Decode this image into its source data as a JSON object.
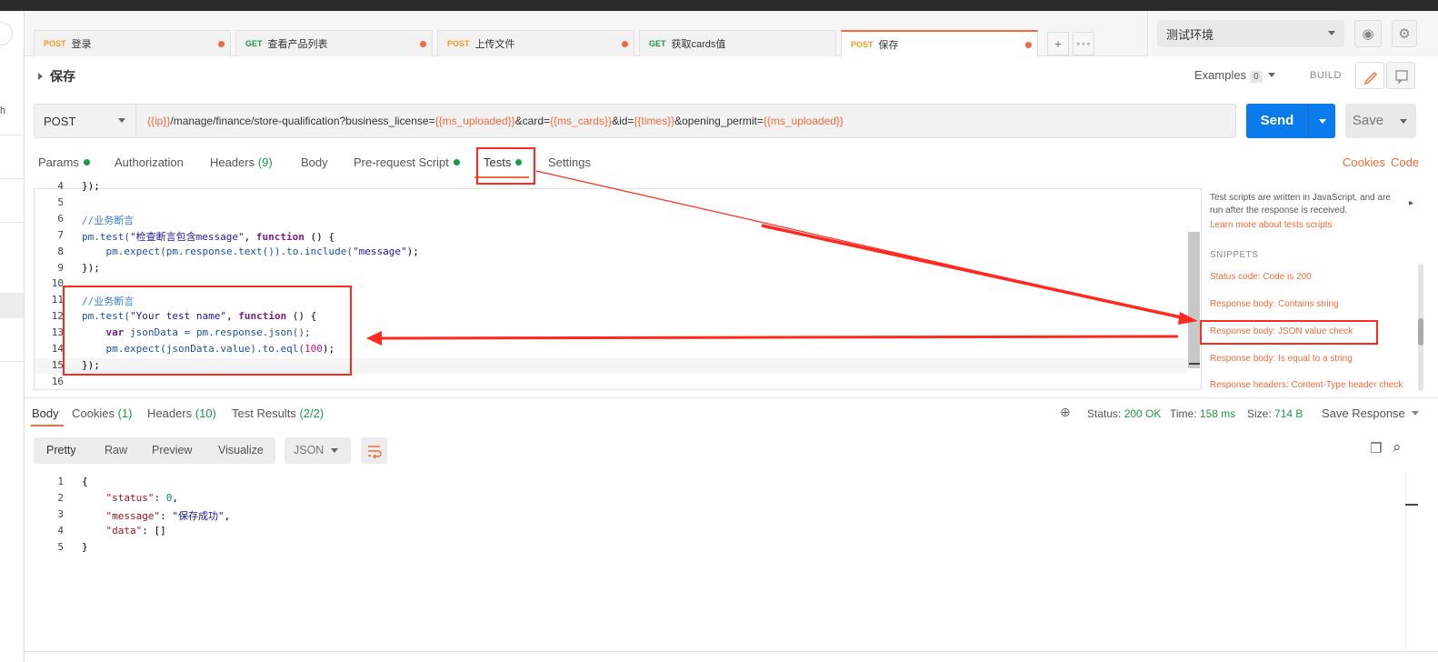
{
  "tabs": [
    {
      "method": "POST",
      "name": "登录"
    },
    {
      "method": "GET",
      "name": "查看产品列表"
    },
    {
      "method": "POST",
      "name": "上传文件"
    },
    {
      "method": "GET",
      "name": "获取cards值"
    },
    {
      "method": "POST",
      "name": "保存"
    }
  ],
  "tab_add_icon": "+",
  "tab_more_icon": "∘∘∘",
  "environment": "测试环境",
  "eye_icon": "◉",
  "settings_icon": "⚙",
  "left_panel_text": "h",
  "request": {
    "name": "保存",
    "examples_label": "Examples",
    "examples_count": "0",
    "build_label": "BUILD",
    "method": "POST",
    "url_parts": {
      "v1": "{{ip}}",
      "t1": "/manage/finance/store-qualification?business_license=",
      "v2": "{{ms_uploaded}}",
      "t2": "&card=",
      "v3": "{{ms_cards}}",
      "t3": "&id=",
      "v4": "{{times}}",
      "t4": "&opening_permit=",
      "v5": "{{ms_uploaded}}"
    },
    "send_label": "Send",
    "save_label": "Save"
  },
  "subtabs": {
    "params": "Params",
    "authorization": "Authorization",
    "headers": "Headers",
    "headers_count": "(9)",
    "body": "Body",
    "prerequest": "Pre-request Script",
    "tests": "Tests",
    "settings": "Settings",
    "cookies": "Cookies",
    "code": "Code"
  },
  "editor": {
    "line_numbers": [
      "4",
      "5",
      "6",
      "7",
      "8",
      "9",
      "10",
      "11",
      "12",
      "13",
      "14",
      "15",
      "16"
    ],
    "l4": "});",
    "l6": "//业务断言",
    "l7a": "pm.test(",
    "l7b": "\"检查断言包含message\"",
    "l7c": ", ",
    "l7d": "function",
    "l7e": " () {",
    "l8a": "    pm.expect(pm.response.text()).to.include(",
    "l8b": "\"message\"",
    "l8c": ");",
    "l9": "});",
    "l11": "//业务断言",
    "l12a": "pm.test(",
    "l12b": "\"Your test name\"",
    "l12c": ", ",
    "l12d": "function",
    "l12e": " () {",
    "l13a": "    ",
    "l13b": "var",
    "l13c": " jsonData = pm.response.json();",
    "l14a": "    pm.expect(jsonData.value).to.eql(",
    "l14b": "100",
    "l14c": ");",
    "l15": "});"
  },
  "snippets": {
    "description": "Test scripts are written in JavaScript, and are run after the response is received.",
    "learn_link": "Learn more about tests scripts",
    "heading": "SNIPPETS",
    "items": [
      "Status code: Code is 200",
      "Response body: Contains string",
      "Response body: JSON value check",
      "Response body: Is equal to a string",
      "Response headers: Content-Type header check"
    ],
    "expand_icon": "▸"
  },
  "response": {
    "tabs": {
      "body": "Body",
      "cookies": "Cookies",
      "cookies_count": "(1)",
      "headers": "Headers",
      "headers_count": "(10)",
      "test_results": "Test Results",
      "test_results_count": "(2/2)"
    },
    "globe_icon": "⊕",
    "status_label": "Status:",
    "status_value": "200 OK",
    "time_label": "Time:",
    "time_value": "158 ms",
    "size_label": "Size:",
    "size_value": "714 B",
    "save_response": "Save Response",
    "view_modes": [
      "Pretty",
      "Raw",
      "Preview",
      "Visualize"
    ],
    "format": "JSON",
    "copy_icon": "❐",
    "search_icon": "⌕",
    "body_line_numbers": [
      "1",
      "2",
      "3",
      "4",
      "5"
    ],
    "b1": "{",
    "b2k": "\"status\"",
    "b2v": "0",
    "b3k": "\"message\"",
    "b3v": "\"保存成功\"",
    "b4k": "\"data\"",
    "b4v": "[]",
    "b5": "}"
  },
  "colors": {
    "accent": "#f26b3a",
    "send": "#097bed",
    "annotation": "#ff2a1f"
  }
}
